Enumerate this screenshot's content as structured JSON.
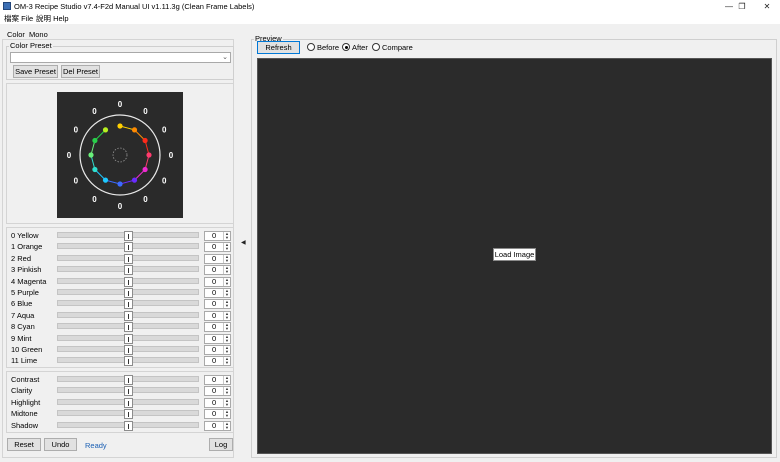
{
  "window": {
    "title": "OM-3 Recipe Studio v7.4-F2d Manual UI v1.11.3g (Clean Frame Labels)",
    "controls": [
      "—",
      "❐",
      "✕"
    ]
  },
  "menu": [
    "檔案 File",
    "說明 Help"
  ],
  "mode_tabs": [
    "Color",
    "Mono"
  ],
  "color_preset": {
    "legend": "Color Preset",
    "selected": "",
    "save_label": "Save Preset",
    "del_label": "Del Preset"
  },
  "wheel": {
    "labels": [
      "0",
      "0",
      "0",
      "0",
      "0",
      "0",
      "0",
      "0",
      "0",
      "0",
      "0",
      "0"
    ],
    "dot_colors": [
      "#ffd000",
      "#ff8a00",
      "#ff2a1a",
      "#ff3b6e",
      "#ef2ad0",
      "#6a2cff",
      "#3b6bff",
      "#1ec8ff",
      "#2fe0d0",
      "#6af07a",
      "#28d04a",
      "#b8f020"
    ]
  },
  "hue_rows": [
    {
      "label": "0  Yellow",
      "value": "0"
    },
    {
      "label": "1  Orange",
      "value": "0"
    },
    {
      "label": "2  Red",
      "value": "0"
    },
    {
      "label": "3  Pinkish",
      "value": "0"
    },
    {
      "label": "4  Magenta",
      "value": "0"
    },
    {
      "label": "5  Purple",
      "value": "0"
    },
    {
      "label": "6  Blue",
      "value": "0"
    },
    {
      "label": "7  Aqua",
      "value": "0"
    },
    {
      "label": "8  Cyan",
      "value": "0"
    },
    {
      "label": "9  Mint",
      "value": "0"
    },
    {
      "label": "10  Green",
      "value": "0"
    },
    {
      "label": "11  Lime",
      "value": "0"
    }
  ],
  "adj_rows": [
    {
      "label": "Contrast",
      "value": "0"
    },
    {
      "label": "Clarity",
      "value": "0"
    },
    {
      "label": "Highlight",
      "value": "0"
    },
    {
      "label": "Midtone",
      "value": "0"
    },
    {
      "label": "Shadow",
      "value": "0"
    }
  ],
  "bottom": {
    "reset_label": "Reset",
    "undo_label": "Undo",
    "status": "Ready",
    "log_label": "Log"
  },
  "preview": {
    "legend": "Preview",
    "refresh_label": "Refresh",
    "modes": [
      {
        "label": "Before",
        "checked": false
      },
      {
        "label": "After",
        "checked": true
      },
      {
        "label": "Compare",
        "checked": false
      }
    ],
    "load_label": "Load Image"
  },
  "colors": {
    "canvas_bg": "#2b2b2b",
    "status_text": "#1a5fb4",
    "focus_border": "#0078d7"
  }
}
